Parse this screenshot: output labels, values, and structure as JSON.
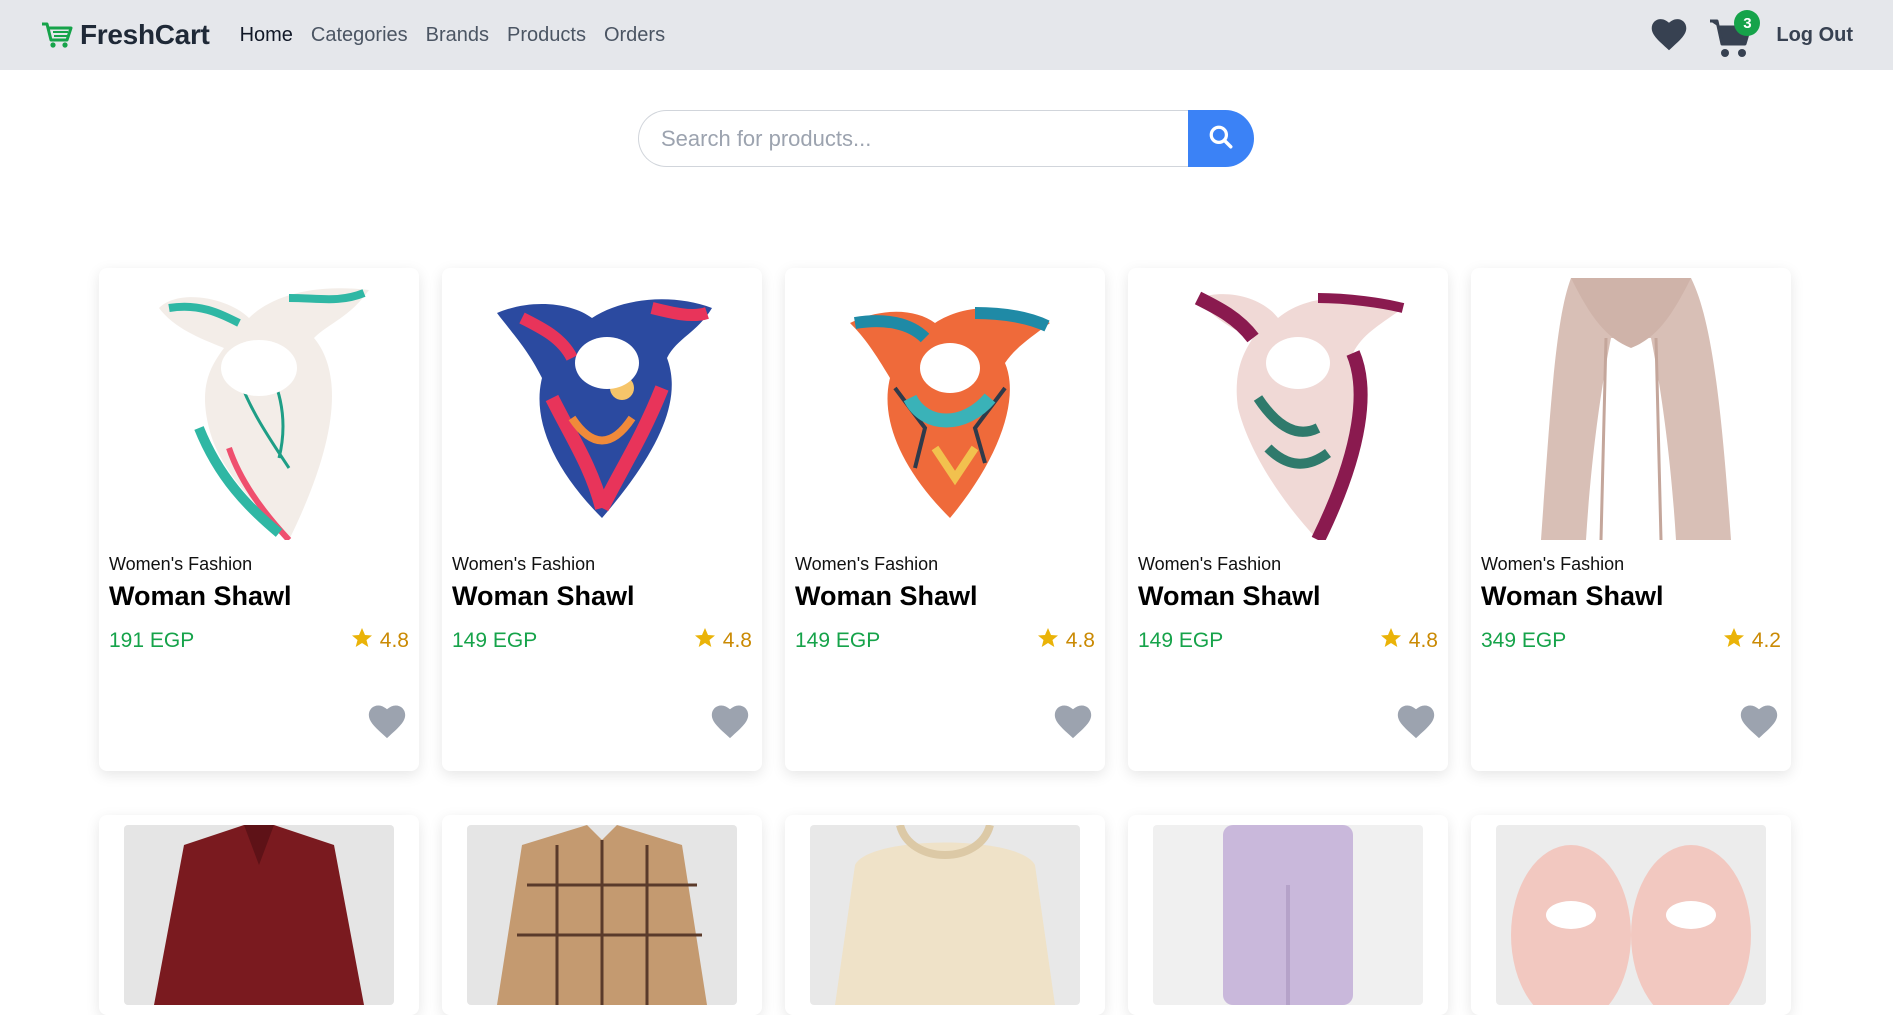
{
  "brand": {
    "name": "FreshCart"
  },
  "nav": {
    "links": [
      "Home",
      "Categories",
      "Brands",
      "Products",
      "Orders"
    ],
    "active": "Home"
  },
  "cart": {
    "count": "3"
  },
  "header": {
    "logout_label": "Log Out"
  },
  "search": {
    "placeholder": "Search for products..."
  },
  "colors": {
    "accent": "#3b82f6",
    "price": "#16a34a",
    "star": "#eab308",
    "navbar_bg": "#e5e7eb",
    "heart_muted": "#9ca3af"
  },
  "products": [
    {
      "category": "Women's Fashion",
      "title": "Woman Shawl",
      "price": "191 EGP",
      "rating": "4.8"
    },
    {
      "category": "Women's Fashion",
      "title": "Woman Shawl",
      "price": "149 EGP",
      "rating": "4.8"
    },
    {
      "category": "Women's Fashion",
      "title": "Woman Shawl",
      "price": "149 EGP",
      "rating": "4.8"
    },
    {
      "category": "Women's Fashion",
      "title": "Woman Shawl",
      "price": "149 EGP",
      "rating": "4.8"
    },
    {
      "category": "Women's Fashion",
      "title": "Woman Shawl",
      "price": "349 EGP",
      "rating": "4.2"
    }
  ]
}
